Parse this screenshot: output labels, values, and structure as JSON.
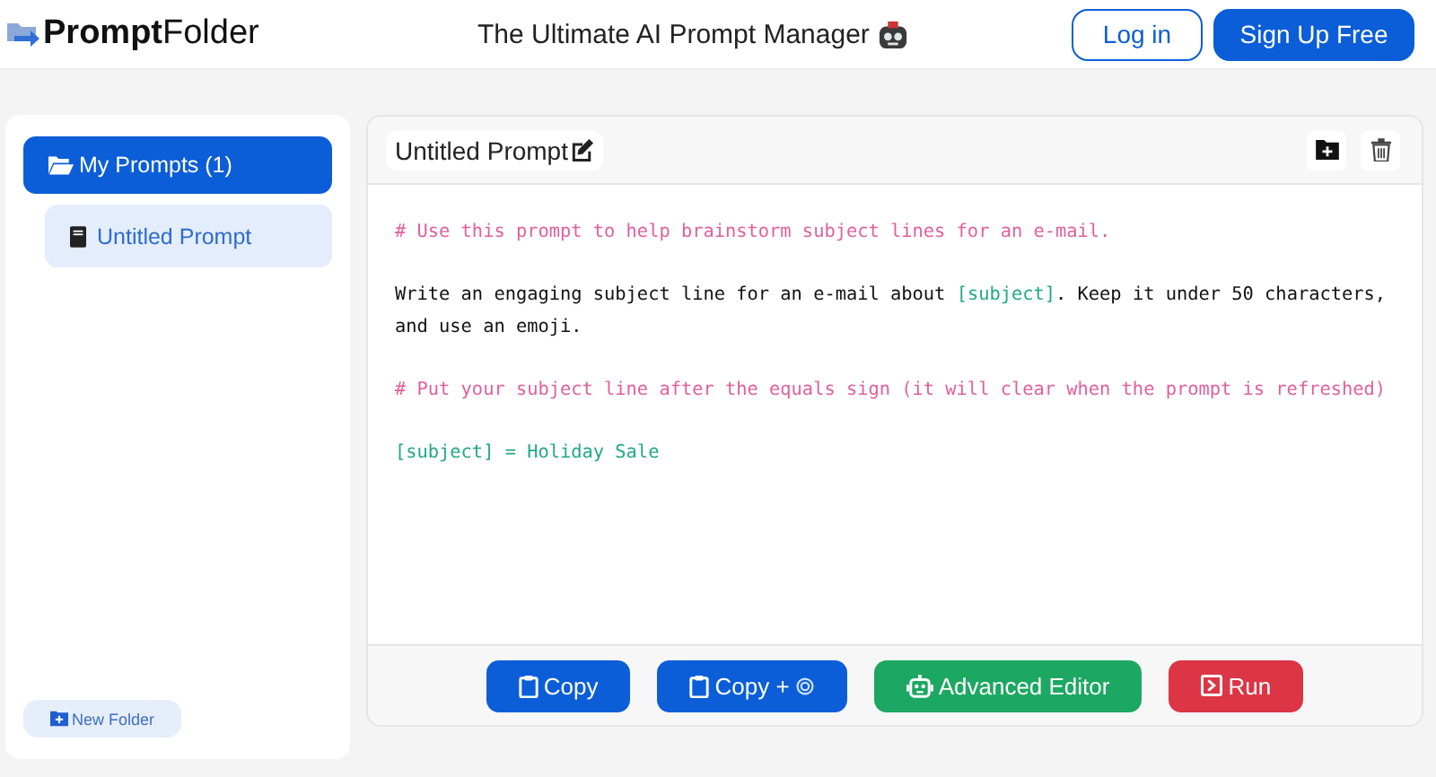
{
  "header": {
    "logo": {
      "bold": "Prompt",
      "light": "Folder"
    },
    "tagline": "The Ultimate AI Prompt Manager",
    "buttons": [
      {
        "label": "Log in",
        "kind": "outline"
      },
      {
        "label": "Sign Up Free",
        "kind": "primary"
      }
    ]
  },
  "sidebar": {
    "folders": [
      {
        "label": "My Prompts (1)",
        "expanded": true,
        "children": [
          {
            "label": "Untitled Prompt",
            "selected": true
          }
        ]
      }
    ],
    "new_folder": "New Folder"
  },
  "prompt": {
    "title": "Untitled Prompt",
    "paragraphs": [
      [
        {
          "kind": "comment",
          "text": "# Use this prompt to help brainstorm subject lines for an e-mail."
        }
      ],
      [
        {
          "kind": "plain",
          "text": "Write an engaging subject line for an e-mail about "
        },
        {
          "kind": "variable",
          "text": "[subject]"
        },
        {
          "kind": "plain",
          "text": ". Keep it under 50 characters, and use an emoji."
        }
      ],
      [
        {
          "kind": "comment",
          "text": "# Put your subject line after the equals sign (it will clear when the prompt is refreshed)"
        }
      ],
      [
        {
          "kind": "variable",
          "text": "[subject] = Holiday Sale"
        }
      ]
    ],
    "actions": [
      {
        "label": "Copy",
        "kind": "copy"
      },
      {
        "label": "Copy +",
        "kind": "copy-ai"
      },
      {
        "label": "Advanced Editor",
        "kind": "editor"
      },
      {
        "label": "Run",
        "kind": "run"
      }
    ]
  }
}
